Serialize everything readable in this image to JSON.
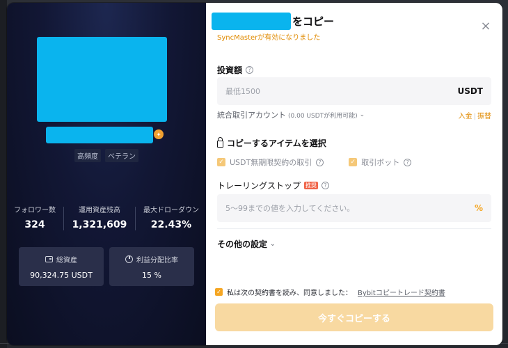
{
  "left": {
    "tags": [
      "高頻度",
      "ベテラン"
    ],
    "stats": [
      {
        "label": "フォロワー数",
        "value": "324"
      },
      {
        "label": "運用資産残高",
        "value": "1,321,609"
      },
      {
        "label": "最大ドローダウン",
        "value": "22.43%"
      }
    ],
    "cards": [
      {
        "label": "総資産",
        "value": "90,324.75 USDT",
        "icon": "wallet-icon"
      },
      {
        "label": "利益分配比率",
        "value": "15 %",
        "icon": "pie-chart-icon"
      }
    ]
  },
  "right": {
    "title_suffix": "をコピー",
    "subtitle": "SyncMasterが有効になりました",
    "close": "×",
    "investment": {
      "label": "投資額",
      "placeholder": "最低1500",
      "unit": "USDT"
    },
    "account": {
      "label": "統合取引アカウント",
      "available": "(0.00 USDTが利用可能)",
      "deposit": "入金",
      "transfer": "振替"
    },
    "items": {
      "label": "コピーするアイテムを選択",
      "options": [
        "USDT無期限契約の取引",
        "取引ボット"
      ]
    },
    "trailing": {
      "label": "トレーリングストップ",
      "badge": "推奨",
      "placeholder": "5～99までの値を入力してください。",
      "unit": "%"
    },
    "other_settings": "その他の設定",
    "agreement": {
      "text": "私は次の契約書を読み、同意しました：",
      "link": "Bybitコピートレード契約書"
    },
    "cta": "今すぐコピーする"
  },
  "colors": {
    "accent": "#f5a623",
    "mask": "#0ab4ee",
    "left_bg": "#121735"
  }
}
